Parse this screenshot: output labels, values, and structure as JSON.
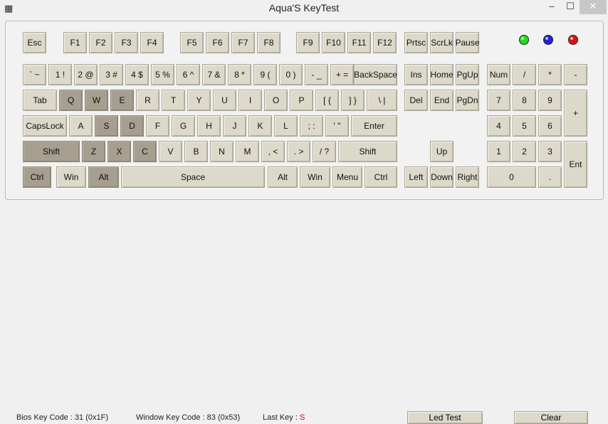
{
  "window": {
    "title": "Aqua'S KeyTest",
    "app_icon": "keyboard-grid-icon",
    "controls": {
      "minimize": "minimize-icon",
      "maximize": "maximize-icon",
      "close": "close-icon"
    }
  },
  "leds": [
    {
      "name": "led-green",
      "color": "#22dd22"
    },
    {
      "name": "led-blue",
      "color": "#2222dd"
    },
    {
      "name": "led-red",
      "color": "#dd1111"
    }
  ],
  "keys": [
    {
      "id": "esc",
      "label": "Esc",
      "pressed": false
    },
    {
      "id": "f1",
      "label": "F1",
      "pressed": false
    },
    {
      "id": "f2",
      "label": "F2",
      "pressed": false
    },
    {
      "id": "f3",
      "label": "F3",
      "pressed": false
    },
    {
      "id": "f4",
      "label": "F4",
      "pressed": false
    },
    {
      "id": "f5",
      "label": "F5",
      "pressed": false
    },
    {
      "id": "f6",
      "label": "F6",
      "pressed": false
    },
    {
      "id": "f7",
      "label": "F7",
      "pressed": false
    },
    {
      "id": "f8",
      "label": "F8",
      "pressed": false
    },
    {
      "id": "f9",
      "label": "F9",
      "pressed": false
    },
    {
      "id": "f10",
      "label": "F10",
      "pressed": false
    },
    {
      "id": "f11",
      "label": "F11",
      "pressed": false
    },
    {
      "id": "f12",
      "label": "F12",
      "pressed": false
    },
    {
      "id": "prtsc",
      "label": "Prtsc",
      "pressed": false
    },
    {
      "id": "scrlk",
      "label": "ScrLk",
      "pressed": false
    },
    {
      "id": "pause",
      "label": "Pause",
      "pressed": false
    },
    {
      "id": "backtick",
      "label": "` ~",
      "pressed": false
    },
    {
      "id": "1",
      "label": "1 !",
      "pressed": false
    },
    {
      "id": "2",
      "label": "2 @",
      "pressed": false
    },
    {
      "id": "3",
      "label": "3 #",
      "pressed": false
    },
    {
      "id": "4",
      "label": "4 $",
      "pressed": false
    },
    {
      "id": "5",
      "label": "5 %",
      "pressed": false
    },
    {
      "id": "6",
      "label": "6 ^",
      "pressed": false
    },
    {
      "id": "7",
      "label": "7 &",
      "pressed": false
    },
    {
      "id": "8",
      "label": "8 *",
      "pressed": false
    },
    {
      "id": "9",
      "label": "9 (",
      "pressed": false
    },
    {
      "id": "0",
      "label": "0 )",
      "pressed": false
    },
    {
      "id": "minus",
      "label": "- _",
      "pressed": false
    },
    {
      "id": "equal",
      "label": "+ =",
      "pressed": false
    },
    {
      "id": "backspace",
      "label": "BackSpace",
      "pressed": false
    },
    {
      "id": "ins",
      "label": "Ins",
      "pressed": false
    },
    {
      "id": "home",
      "label": "Home",
      "pressed": false
    },
    {
      "id": "pgup",
      "label": "PgUp",
      "pressed": false
    },
    {
      "id": "numlock",
      "label": "Num",
      "pressed": false
    },
    {
      "id": "numdiv",
      "label": "/",
      "pressed": false
    },
    {
      "id": "nummul",
      "label": "*",
      "pressed": false
    },
    {
      "id": "numsub",
      "label": "-",
      "pressed": false
    },
    {
      "id": "tab",
      "label": "Tab",
      "pressed": false
    },
    {
      "id": "q",
      "label": "Q",
      "pressed": true
    },
    {
      "id": "w",
      "label": "W",
      "pressed": true
    },
    {
      "id": "e",
      "label": "E",
      "pressed": true
    },
    {
      "id": "r",
      "label": "R",
      "pressed": false
    },
    {
      "id": "t",
      "label": "T",
      "pressed": false
    },
    {
      "id": "y",
      "label": "Y",
      "pressed": false
    },
    {
      "id": "u",
      "label": "U",
      "pressed": false
    },
    {
      "id": "i",
      "label": "I",
      "pressed": false
    },
    {
      "id": "o",
      "label": "O",
      "pressed": false
    },
    {
      "id": "p",
      "label": "P",
      "pressed": false
    },
    {
      "id": "lbracket",
      "label": "[ {",
      "pressed": false
    },
    {
      "id": "rbracket",
      "label": "] }",
      "pressed": false
    },
    {
      "id": "backslash",
      "label": "\\ |",
      "pressed": false
    },
    {
      "id": "del",
      "label": "Del",
      "pressed": false
    },
    {
      "id": "end",
      "label": "End",
      "pressed": false
    },
    {
      "id": "pgdn",
      "label": "PgDn",
      "pressed": false
    },
    {
      "id": "num7",
      "label": "7",
      "pressed": false
    },
    {
      "id": "num8",
      "label": "8",
      "pressed": false
    },
    {
      "id": "num9",
      "label": "9",
      "pressed": false
    },
    {
      "id": "numadd",
      "label": "+",
      "pressed": false
    },
    {
      "id": "capslock",
      "label": "CapsLock",
      "pressed": false
    },
    {
      "id": "a",
      "label": "A",
      "pressed": false
    },
    {
      "id": "s",
      "label": "S",
      "pressed": true
    },
    {
      "id": "d",
      "label": "D",
      "pressed": true
    },
    {
      "id": "f",
      "label": "F",
      "pressed": false
    },
    {
      "id": "g",
      "label": "G",
      "pressed": false
    },
    {
      "id": "h",
      "label": "H",
      "pressed": false
    },
    {
      "id": "j",
      "label": "J",
      "pressed": false
    },
    {
      "id": "k",
      "label": "K",
      "pressed": false
    },
    {
      "id": "l",
      "label": "L",
      "pressed": false
    },
    {
      "id": "semicolon",
      "label": "; :",
      "pressed": false
    },
    {
      "id": "quote",
      "label": "' \"",
      "pressed": false
    },
    {
      "id": "enter",
      "label": "Enter",
      "pressed": false
    },
    {
      "id": "num4",
      "label": "4",
      "pressed": false
    },
    {
      "id": "num5",
      "label": "5",
      "pressed": false
    },
    {
      "id": "num6",
      "label": "6",
      "pressed": false
    },
    {
      "id": "lshift",
      "label": "Shift",
      "pressed": true
    },
    {
      "id": "z",
      "label": "Z",
      "pressed": true
    },
    {
      "id": "x",
      "label": "X",
      "pressed": true
    },
    {
      "id": "c",
      "label": "C",
      "pressed": true
    },
    {
      "id": "v",
      "label": "V",
      "pressed": false
    },
    {
      "id": "b",
      "label": "B",
      "pressed": false
    },
    {
      "id": "n",
      "label": "N",
      "pressed": false
    },
    {
      "id": "m",
      "label": "M",
      "pressed": false
    },
    {
      "id": "comma",
      "label": ", <",
      "pressed": false
    },
    {
      "id": "period",
      "label": ". >",
      "pressed": false
    },
    {
      "id": "slash",
      "label": "/ ?",
      "pressed": false
    },
    {
      "id": "rshift",
      "label": "Shift",
      "pressed": false
    },
    {
      "id": "up",
      "label": "Up",
      "pressed": false
    },
    {
      "id": "num1",
      "label": "1",
      "pressed": false
    },
    {
      "id": "num2",
      "label": "2",
      "pressed": false
    },
    {
      "id": "num3",
      "label": "3",
      "pressed": false
    },
    {
      "id": "numenter",
      "label": "Ent",
      "pressed": false
    },
    {
      "id": "lctrl",
      "label": "Ctrl",
      "pressed": true
    },
    {
      "id": "lwin",
      "label": "Win",
      "pressed": false
    },
    {
      "id": "lalt",
      "label": "Alt",
      "pressed": true
    },
    {
      "id": "space",
      "label": "Space",
      "pressed": false
    },
    {
      "id": "ralt",
      "label": "Alt",
      "pressed": false
    },
    {
      "id": "rwin",
      "label": "Win",
      "pressed": false
    },
    {
      "id": "menu",
      "label": "Menu",
      "pressed": false
    },
    {
      "id": "rctrl",
      "label": "Ctrl",
      "pressed": false
    },
    {
      "id": "left",
      "label": "Left",
      "pressed": false
    },
    {
      "id": "down",
      "label": "Down",
      "pressed": false
    },
    {
      "id": "right",
      "label": "Right",
      "pressed": false
    },
    {
      "id": "num0",
      "label": "0",
      "pressed": false
    },
    {
      "id": "numdot",
      "label": ".",
      "pressed": false
    }
  ],
  "status": {
    "bios_label": "Bios Key Code :",
    "bios_value": "31 (0x1F)",
    "window_label": "Window Key Code :",
    "window_value": "83 (0x53)",
    "last_key_label": "Last Key :",
    "last_key_value": "S",
    "led_test_label": "Led Test",
    "clear_label": "Clear"
  }
}
